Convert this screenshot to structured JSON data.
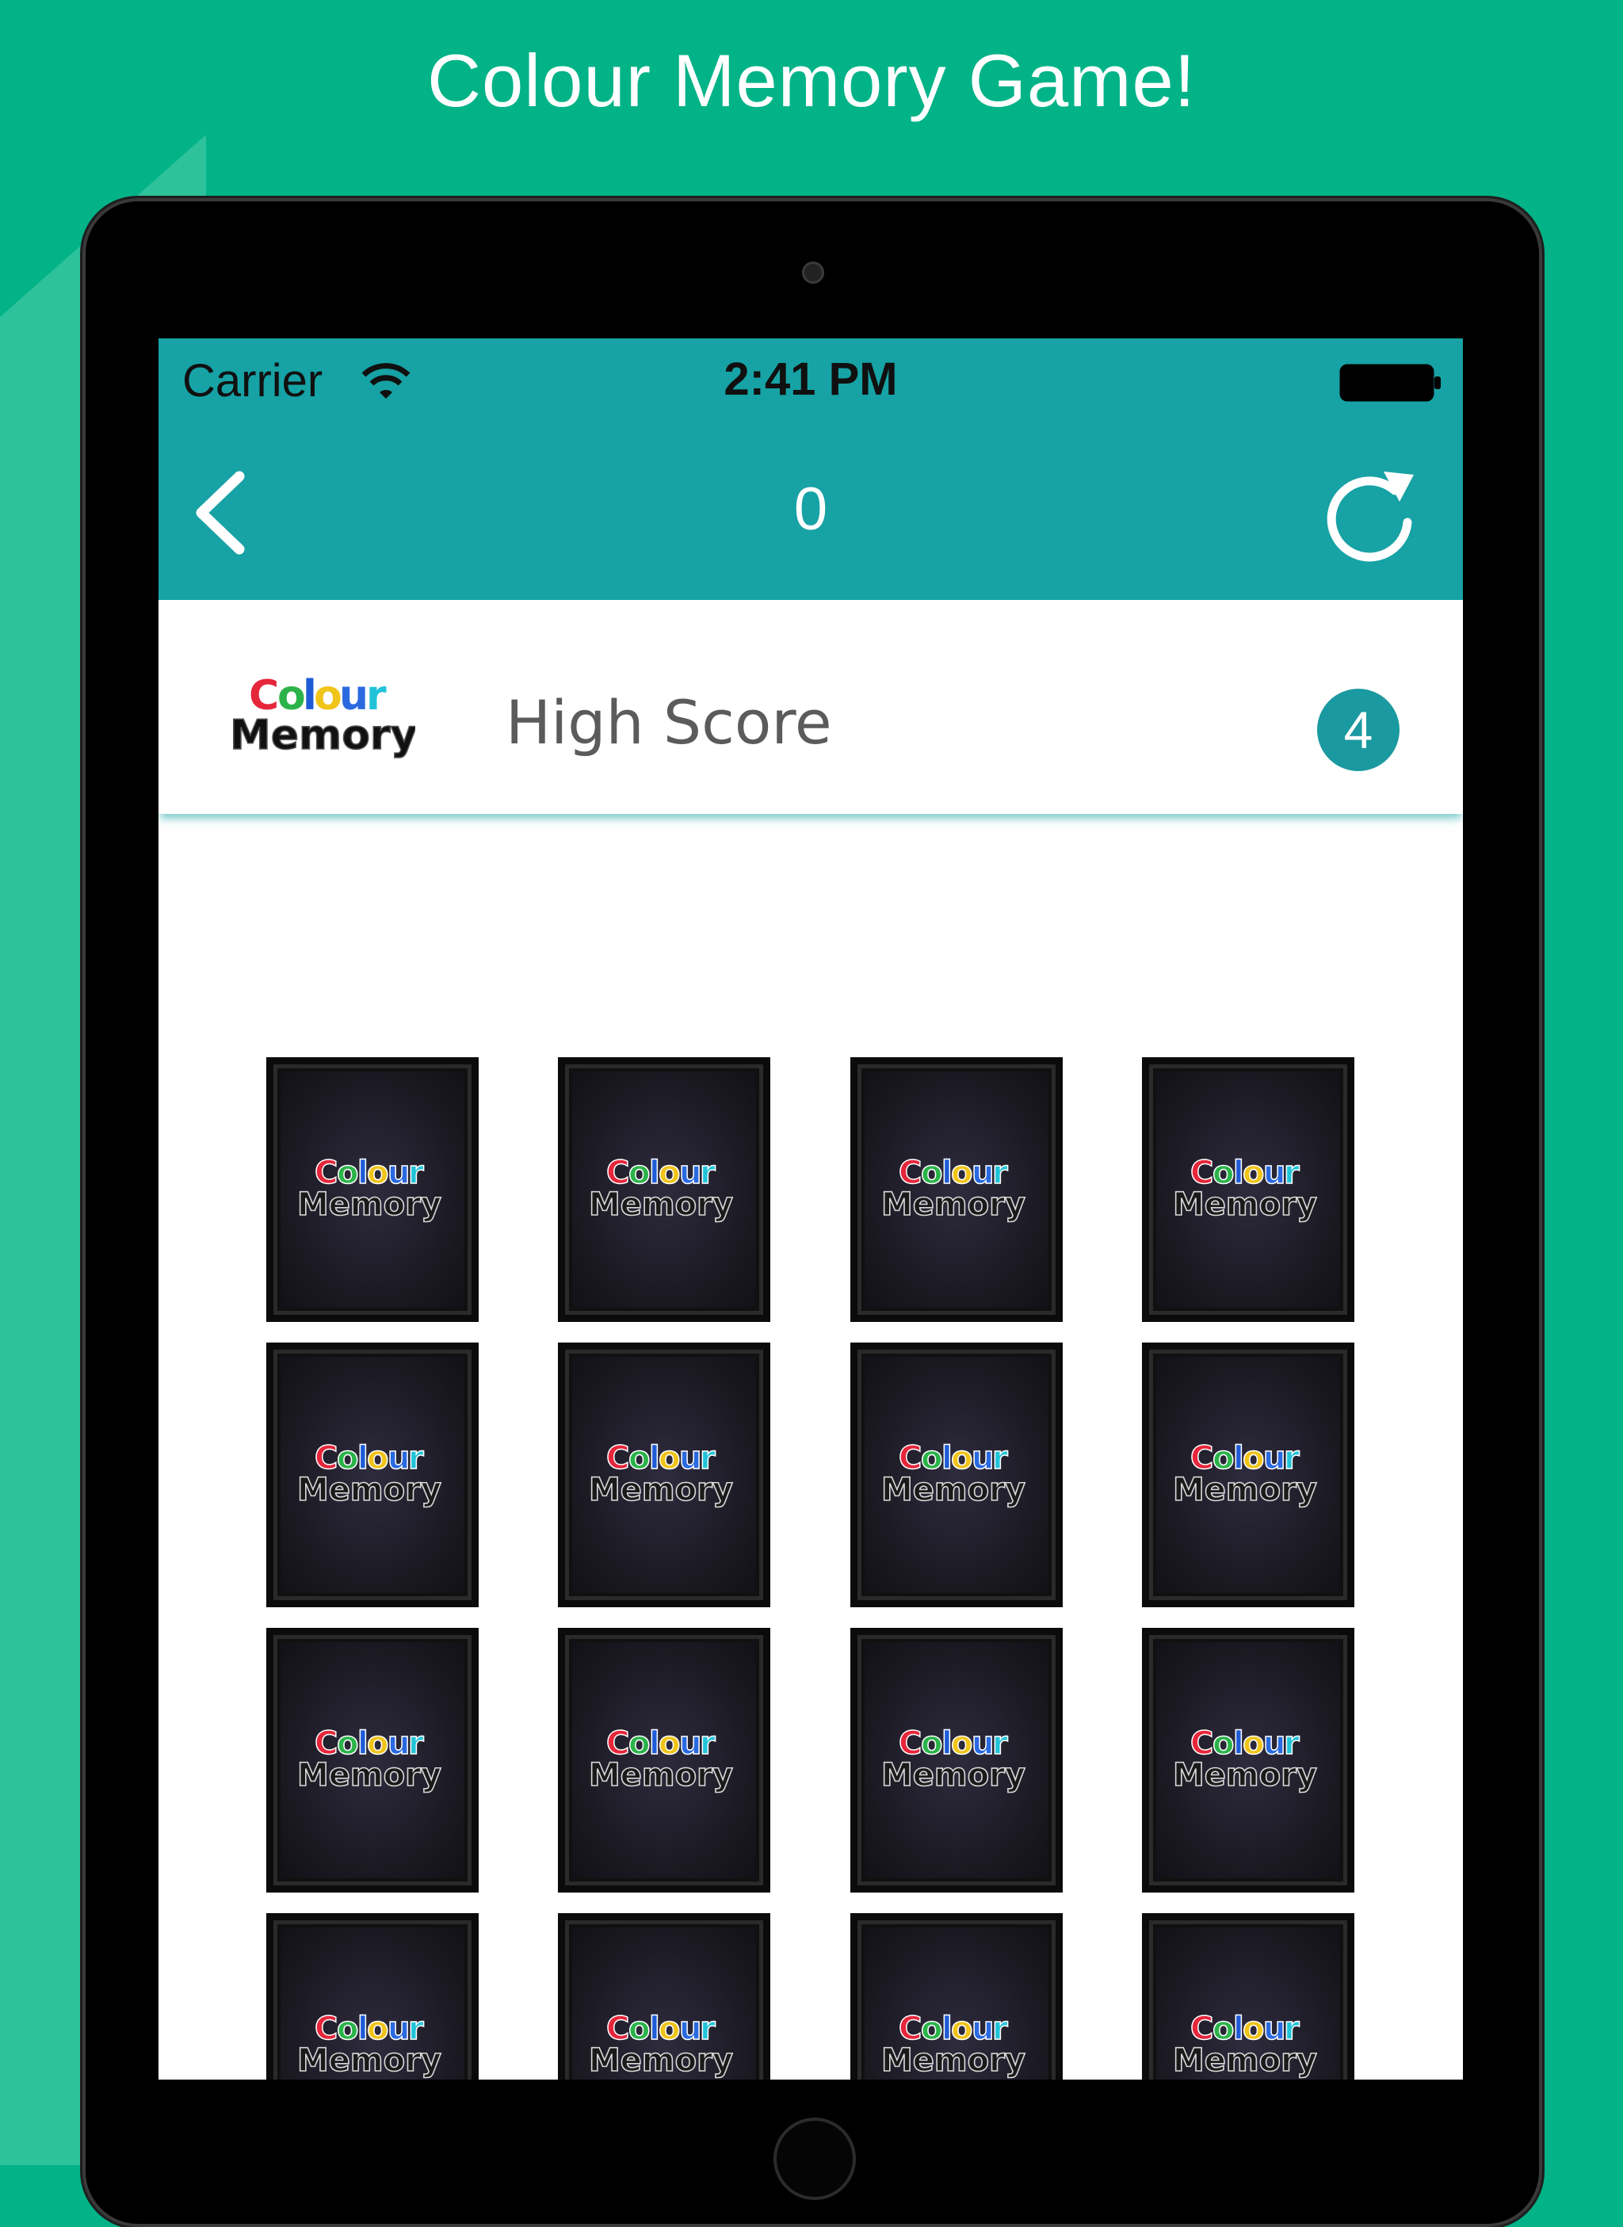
{
  "headline": "Colour Memory Game!",
  "status_bar": {
    "carrier": "Carrier",
    "time": "2:41 PM"
  },
  "nav_bar": {
    "score": "0"
  },
  "high_score": {
    "label": "High Score",
    "value": "4"
  },
  "logo": {
    "line1": "Colour",
    "line2": "Memory"
  },
  "cards": {
    "count": 16,
    "columns": 4,
    "state": "face-down"
  },
  "colors": {
    "background": "#02b387",
    "nav_bar": "#17a2a5",
    "badge": "#1a9aa0",
    "card_back": "#1b1a23",
    "logo_letters": [
      "#e5263b",
      "#2bb34a",
      "#1e5bd6",
      "#f0c419",
      "#2a69e0",
      "#22c3d8"
    ]
  },
  "icons": {
    "back": "chevron-left-icon",
    "restart": "refresh-icon",
    "wifi": "wifi-icon",
    "battery": "battery-icon"
  }
}
